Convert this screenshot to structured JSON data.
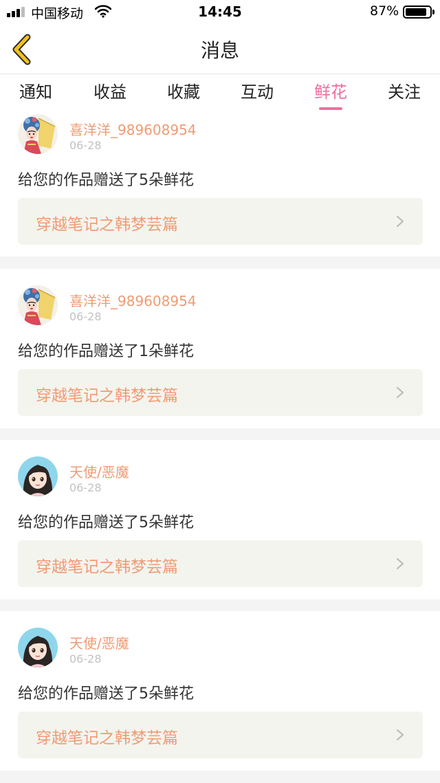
{
  "status_bar": {
    "carrier": "中国移动",
    "time": "14:45",
    "battery_text": "87%",
    "battery_level": 0.87
  },
  "nav": {
    "title": "消息",
    "back_icon": "chevron-left-icon",
    "accent_color": "#f2c21b"
  },
  "tabs": [
    {
      "label": "通知",
      "active": false
    },
    {
      "label": "收益",
      "active": false
    },
    {
      "label": "收藏",
      "active": false
    },
    {
      "label": "互动",
      "active": false
    },
    {
      "label": "鲜花",
      "active": true
    },
    {
      "label": "关注",
      "active": false
    }
  ],
  "colors": {
    "active_tab": "#ee6fa0",
    "username": "#ef9b74",
    "work_link_bg": "#f4f4ee"
  },
  "messages": [
    {
      "avatar": "opera-mask-avatar",
      "username": "喜洋洋_989608954",
      "date": "06-28",
      "text": "给您的作品赠送了5朵鲜花",
      "work_title": "穿越笔记之韩梦芸篇"
    },
    {
      "avatar": "opera-mask-avatar",
      "username": "喜洋洋_989608954",
      "date": "06-28",
      "text": "给您的作品赠送了1朵鲜花",
      "work_title": "穿越笔记之韩梦芸篇"
    },
    {
      "avatar": "cartoon-girl-avatar",
      "username": "天使/恶魔",
      "date": "06-28",
      "text": "给您的作品赠送了5朵鲜花",
      "work_title": "穿越笔记之韩梦芸篇"
    },
    {
      "avatar": "cartoon-girl-avatar",
      "username": "天使/恶魔",
      "date": "06-28",
      "text": "给您的作品赠送了5朵鲜花",
      "work_title": "穿越笔记之韩梦芸篇"
    }
  ]
}
